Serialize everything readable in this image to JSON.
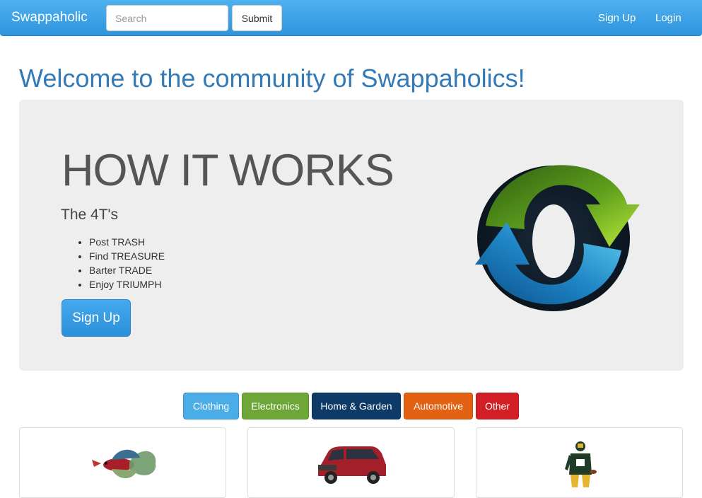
{
  "navbar": {
    "brand": "Swappaholic",
    "search_placeholder": "Search",
    "submit_label": "Submit",
    "links": [
      {
        "label": "Sign Up"
      },
      {
        "label": "Login"
      }
    ]
  },
  "main": {
    "welcome_title": "Welcome to the community of Swappaholics!",
    "jumbotron": {
      "heading": "HOW IT WORKS",
      "subheading": "The 4T's",
      "steps": [
        "Post TRASH",
        "Find TREASURE",
        "Barter TRADE",
        "Enjoy TRIUMPH"
      ],
      "button_label": "Sign Up",
      "logo_icon": "swap-arrows-icon"
    },
    "categories": [
      {
        "label": "Clothing",
        "color": "#4bade8"
      },
      {
        "label": "Electronics",
        "color": "#6ea737"
      },
      {
        "label": "Home & Garden",
        "color": "#0d3a66"
      },
      {
        "label": "Automotive",
        "color": "#e36112"
      },
      {
        "label": "Other",
        "color": "#d21e25"
      }
    ],
    "items": [
      {
        "image": "betta-fish-image"
      },
      {
        "image": "red-suv-image"
      },
      {
        "image": "football-player-image"
      }
    ]
  }
}
